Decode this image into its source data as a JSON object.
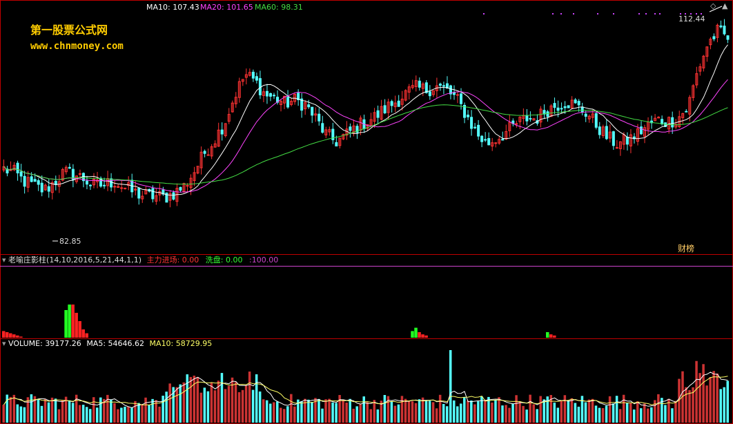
{
  "watermark": {
    "title": "第一股票公式网",
    "url": "www.chnmoney.com"
  },
  "main_panel": {
    "ma_labels": [
      {
        "key": "MA10:",
        "value": "107.43",
        "color": "#ffffff"
      },
      {
        "key": "MA20:",
        "value": "101.65",
        "color": "#ff44ff"
      },
      {
        "key": "MA60:",
        "value": "98.31",
        "color": "#44dd44"
      }
    ],
    "high_label": "112.44",
    "low_label": "82.85",
    "badge": "财榜"
  },
  "indicator_panel": {
    "title": "老喻庄影柱(14,10,2016,5,21,44,1,1)",
    "items": [
      {
        "key": "主力进场:",
        "value": "0.00",
        "color": "#ff3333"
      },
      {
        "key": "洗盘:",
        "value": "0.00",
        "color": "#33ff33"
      },
      {
        "key": ":",
        "value": "100.00",
        "color": "#cc44cc"
      }
    ]
  },
  "volume_panel": {
    "items": [
      {
        "key": "VOLUME:",
        "value": "39177.26",
        "color": "#ffffff"
      },
      {
        "key": "MA5:",
        "value": "54646.62",
        "color": "#ffffff"
      },
      {
        "key": "MA10:",
        "value": "58729.95",
        "color": "#ffff66"
      }
    ]
  },
  "colors": {
    "up": "#ff3333",
    "down": "#54ffff",
    "ma10": "#ffffff",
    "ma20": "#ff44ff",
    "ma60": "#44dd44",
    "frame": "#c00000"
  },
  "chart_data": {
    "type": "candlestick",
    "x_axis": "trading days (unlabeled)",
    "y_range_shown": [
      80,
      116
    ],
    "key_points": [
      {
        "label": "low",
        "value": 82.85
      },
      {
        "label": "high",
        "value": 112.44
      }
    ],
    "price_path_approx": [
      92,
      91.5,
      90.2,
      89.5,
      88.8,
      90,
      91.5,
      91.2,
      90.5,
      89.5,
      89.7,
      90.2,
      89.2,
      88.5,
      88,
      88,
      87.8,
      88.5,
      89.5,
      91.8,
      94.5,
      96.5,
      99,
      103,
      106,
      105,
      103,
      102.5,
      101.7,
      102.2,
      101.5,
      99.5,
      97.2,
      96,
      97,
      98.2,
      99,
      99.8,
      101,
      102,
      103.2,
      104,
      103.7,
      104.3,
      103.7,
      102.4,
      100,
      97.3,
      95.7,
      96.5,
      97.5,
      98.7,
      99.5,
      99.5,
      100.8,
      101.5,
      102,
      101.2,
      100.3,
      98.4,
      96.7,
      95.7,
      96.2,
      97.2,
      98.4,
      99.3,
      99,
      99.5,
      101,
      106.5,
      110.5,
      112.4,
      111.4
    ],
    "series": [
      {
        "name": "MA10",
        "last": 107.43
      },
      {
        "name": "MA20",
        "last": 101.65
      },
      {
        "name": "MA60",
        "last": 98.31
      }
    ],
    "indicator": {
      "name": "老喻庄影柱",
      "clusters": [
        {
          "position": "early",
          "green_bars": [
            0.5,
            0.6
          ],
          "red_bars": [
            0.6,
            0.45,
            0.3,
            0.15,
            0.08
          ]
        },
        {
          "position": "mid",
          "green_bars": [
            0.12,
            0.18
          ],
          "red_bars": [
            0.1,
            0.06,
            0.04
          ]
        },
        {
          "position": "late",
          "green_bars": [
            0.1
          ],
          "red_bars": [
            0.06,
            0.04
          ]
        }
      ]
    },
    "volume": {
      "name": "VOLUME",
      "current": 39177.26,
      "ma5": 54646.62,
      "ma10": 58729.95,
      "peak_position": "near day 90"
    }
  }
}
